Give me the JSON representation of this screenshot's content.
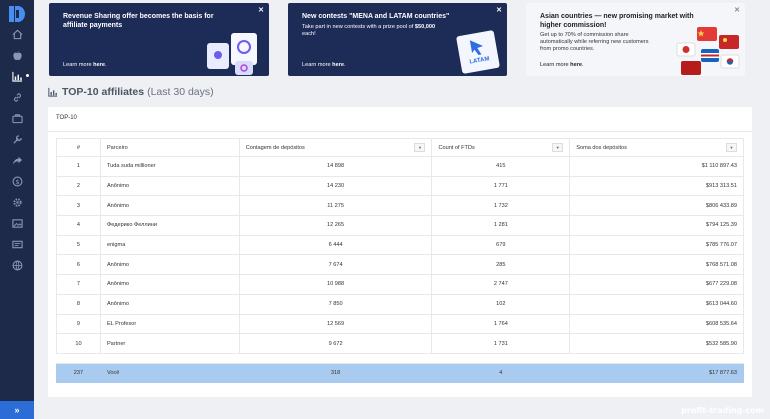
{
  "banners": [
    {
      "title": "Revenue Sharing offer becomes the basis for affiliate payments",
      "body": "",
      "learn_prefix": "Learn more",
      "learn_link": "here",
      "learn_suffix": "."
    },
    {
      "title": "New contests \"MENA and LATAM countries\"",
      "body_pre": "Take part in new contests with a prize pool of",
      "body_bold": "$50,000",
      "body_post": "each!",
      "badge": "LATAM",
      "learn_prefix": "Learn more",
      "learn_link": "here",
      "learn_suffix": "."
    },
    {
      "title": "Asian countries — new promising market with higher commission!",
      "body": "Get up to 70% of commission share automatically while referring new customers from promo countries.",
      "learn_prefix": "Learn more",
      "learn_link": "here",
      "learn_suffix": "."
    }
  ],
  "heading": {
    "main": "TOP-10 affiliates",
    "sub": "(Last 30 days)"
  },
  "panel": {
    "title": "TOP-10"
  },
  "table": {
    "headers": [
      "#",
      "Parceiro",
      "Contagem de depósitos",
      "Count of FTDs",
      "Soma dos depósitos"
    ],
    "rows": [
      [
        "1",
        "Tuda suda millioner",
        "14 898",
        "415",
        "$1 110 897.43"
      ],
      [
        "2",
        "Anônimo",
        "14 230",
        "1 771",
        "$913 313.51"
      ],
      [
        "3",
        "Anônimo",
        "11 275",
        "1 732",
        "$806 433.89"
      ],
      [
        "4",
        "Федерико Феллини",
        "12 265",
        "1 281",
        "$794 125.39"
      ],
      [
        "5",
        "enigma",
        "6 444",
        "679",
        "$785 776.07"
      ],
      [
        "6",
        "Anônimo",
        "7 674",
        "285",
        "$768 571.08"
      ],
      [
        "7",
        "Anônimo",
        "10 988",
        "2 747",
        "$677 229.08"
      ],
      [
        "8",
        "Anônimo",
        "7 850",
        "102",
        "$613 044.60"
      ],
      [
        "9",
        "EL Profesor",
        "12 569",
        "1 764",
        "$608 535.64"
      ],
      [
        "10",
        "Partner",
        "9 672",
        "1 731",
        "$532 585.90"
      ]
    ],
    "total": [
      "237",
      "Você",
      "318",
      "4",
      "$17 877.63"
    ]
  },
  "sidebar_icons": [
    "home-icon",
    "apple-icon",
    "chart-icon",
    "link-icon",
    "briefcase-icon",
    "tools-icon",
    "share-icon",
    "dollar-icon",
    "gear-icon",
    "image-icon",
    "id-card-icon",
    "globe-icon"
  ],
  "watermark": "profit-trading.com",
  "colors": {
    "sidebar": "#1e2a4a",
    "banner_dark": "#1d2b57",
    "highlight_row": "#a9cbf0",
    "accent": "#2b6cd6"
  }
}
